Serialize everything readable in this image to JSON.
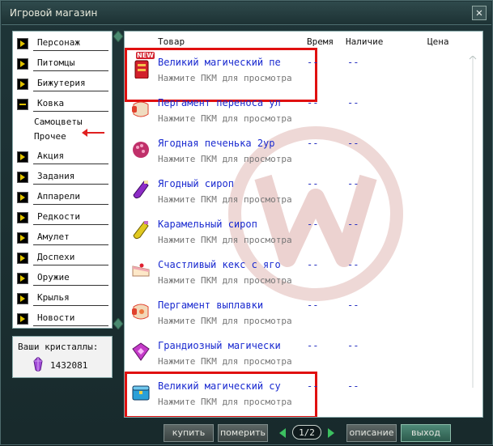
{
  "window": {
    "title": "Игровой магазин",
    "close_label": "✕"
  },
  "categories": [
    {
      "label": "Персонаж",
      "open": false
    },
    {
      "label": "Питомцы",
      "open": false
    },
    {
      "label": "Бижутерия",
      "open": false
    },
    {
      "label": "Ковка",
      "open": true
    },
    {
      "label": "Акция",
      "open": false
    },
    {
      "label": "Задания",
      "open": false
    },
    {
      "label": "Аппарели",
      "open": false
    },
    {
      "label": "Редкости",
      "open": false
    },
    {
      "label": "Амулет",
      "open": false
    },
    {
      "label": "Доспехи",
      "open": false
    },
    {
      "label": "Оружие",
      "open": false
    },
    {
      "label": "Крылья",
      "open": false
    },
    {
      "label": "Новости",
      "open": false
    }
  ],
  "subcategories": [
    "Самоцветы",
    "Прочее"
  ],
  "crystals": {
    "label": "Ваши кристаллы:",
    "value": "1432081"
  },
  "columns": {
    "item": "Товар",
    "time": "Время",
    "availability": "Наличие",
    "price": "Цена"
  },
  "items": [
    {
      "name": "Великий магический пе",
      "hint": "Нажмите ПКМ для просмотра",
      "time": "--",
      "availability": "--",
      "icon": "new-scroll-icon",
      "badge": "NEW",
      "color": "#d21f2b"
    },
    {
      "name": "Пергамент переноса ул",
      "hint": "Нажмите ПКМ для просмотра",
      "time": "--",
      "availability": "--",
      "icon": "parchment-scroll-icon",
      "color": "#e0412d"
    },
    {
      "name": "Ягодная печенька 2ур",
      "hint": "Нажмите ПКМ для просмотра",
      "time": "--",
      "availability": "--",
      "icon": "berry-cookie-icon",
      "color": "#c0306a"
    },
    {
      "name": "Ягодный сироп",
      "hint": "Нажмите ПКМ для просмотра",
      "time": "--",
      "availability": "--",
      "icon": "purple-bottle-icon",
      "color": "#8d2cc6"
    },
    {
      "name": "Карамельный сироп",
      "hint": "Нажмите ПКМ для просмотра",
      "time": "--",
      "availability": "--",
      "icon": "yellow-bottle-icon",
      "color": "#e0c820"
    },
    {
      "name": "Счастливый кекс с яго",
      "hint": "Нажмите ПКМ для просмотра",
      "time": "--",
      "availability": "--",
      "icon": "cake-slice-icon",
      "color": "#f0a6b0"
    },
    {
      "name": "Пергамент выплавки",
      "hint": "Нажмите ПКМ для просмотра",
      "time": "--",
      "availability": "--",
      "icon": "smelting-scroll-icon",
      "color": "#e0412d"
    },
    {
      "name": "Грандиозный магически",
      "hint": "Нажмите ПКМ для просмотра",
      "time": "--",
      "availability": "--",
      "icon": "magic-gem-icon",
      "color": "#c43ac8"
    },
    {
      "name": "Великий магический су",
      "hint": "Нажмите ПКМ для просмотра",
      "time": "--",
      "availability": "--",
      "icon": "blue-chest-icon",
      "color": "#2aa0d8"
    }
  ],
  "footer": {
    "buy": "купить",
    "try_on": "померить",
    "page": "1/2",
    "description": "описание",
    "exit": "выход"
  }
}
